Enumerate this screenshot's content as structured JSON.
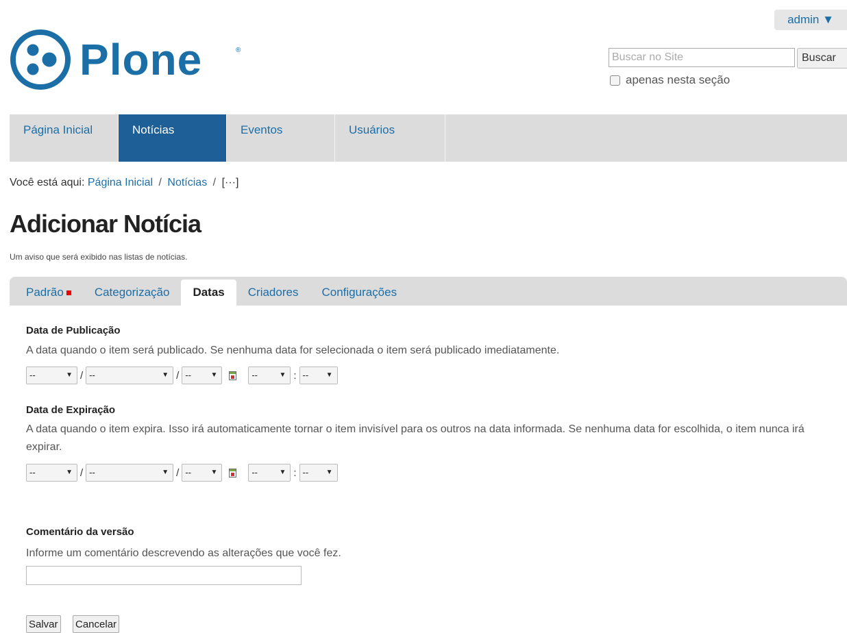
{
  "user_menu": {
    "label": "admin ▼"
  },
  "logo": {
    "text": "Plone",
    "reg": "®"
  },
  "search": {
    "placeholder": "Buscar no Site",
    "button_label": "Buscar",
    "section_label": "apenas nesta seção"
  },
  "nav": {
    "items": [
      {
        "label": "Página Inicial",
        "active": false
      },
      {
        "label": "Notícias",
        "active": true
      },
      {
        "label": "Eventos",
        "active": false
      },
      {
        "label": "Usuários",
        "active": false
      }
    ]
  },
  "breadcrumb": {
    "prefix": "Você está aqui:",
    "items": [
      "Página Inicial",
      "Notícias",
      "[···]"
    ],
    "separator": "/"
  },
  "page": {
    "title": "Adicionar Notícia",
    "description": "Um aviso que será exibido nas listas de notícias."
  },
  "tabs": [
    {
      "label": "Padrão",
      "required": true
    },
    {
      "label": "Categorização"
    },
    {
      "label": "Datas",
      "active": true
    },
    {
      "label": "Criadores"
    },
    {
      "label": "Configurações"
    }
  ],
  "fields": {
    "publication": {
      "label": "Data de Publicação",
      "help": "A data quando o item será publicado. Se nenhuma data for selecionada o item será publicado imediatamente."
    },
    "expiration": {
      "label": "Data de Expiração",
      "help": "A data quando o item expira. Isso irá automaticamente tornar o item invisível para os outros na data informada. Se nenhuma data for escolhida, o item nunca irá expirar."
    },
    "version_comment": {
      "label": "Comentário da versão",
      "help": "Informe um comentário descrevendo as alterações que você fez.",
      "value": ""
    }
  },
  "date_select": {
    "empty": "--",
    "arrow": "▼",
    "date_sep": "/",
    "time_sep": ":"
  },
  "actions": {
    "save": "Salvar",
    "cancel": "Cancelar"
  },
  "colors": {
    "accent": "#1c6ea7",
    "nav_active": "#1f5f98",
    "required": "#ee0000"
  }
}
